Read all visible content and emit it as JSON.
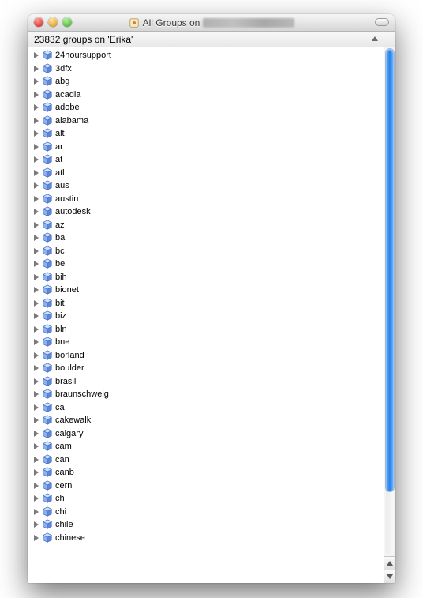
{
  "window": {
    "title_prefix": "All Groups on",
    "title_hidden": true
  },
  "header": {
    "count": 23832,
    "server": "Erika",
    "text_template": "{count} groups on '{server}'"
  },
  "groups": [
    "24hoursupport",
    "3dfx",
    "abg",
    "acadia",
    "adobe",
    "alabama",
    "alt",
    "ar",
    "at",
    "atl",
    "aus",
    "austin",
    "autodesk",
    "az",
    "ba",
    "bc",
    "be",
    "bih",
    "bionet",
    "bit",
    "biz",
    "bln",
    "bne",
    "borland",
    "boulder",
    "brasil",
    "braunschweig",
    "ca",
    "cakewalk",
    "calgary",
    "cam",
    "can",
    "canb",
    "cern",
    "ch",
    "chi",
    "chile",
    "chinese"
  ],
  "scrollbar": {
    "thumb_pos": 0,
    "thumb_ratio": 0.82
  }
}
